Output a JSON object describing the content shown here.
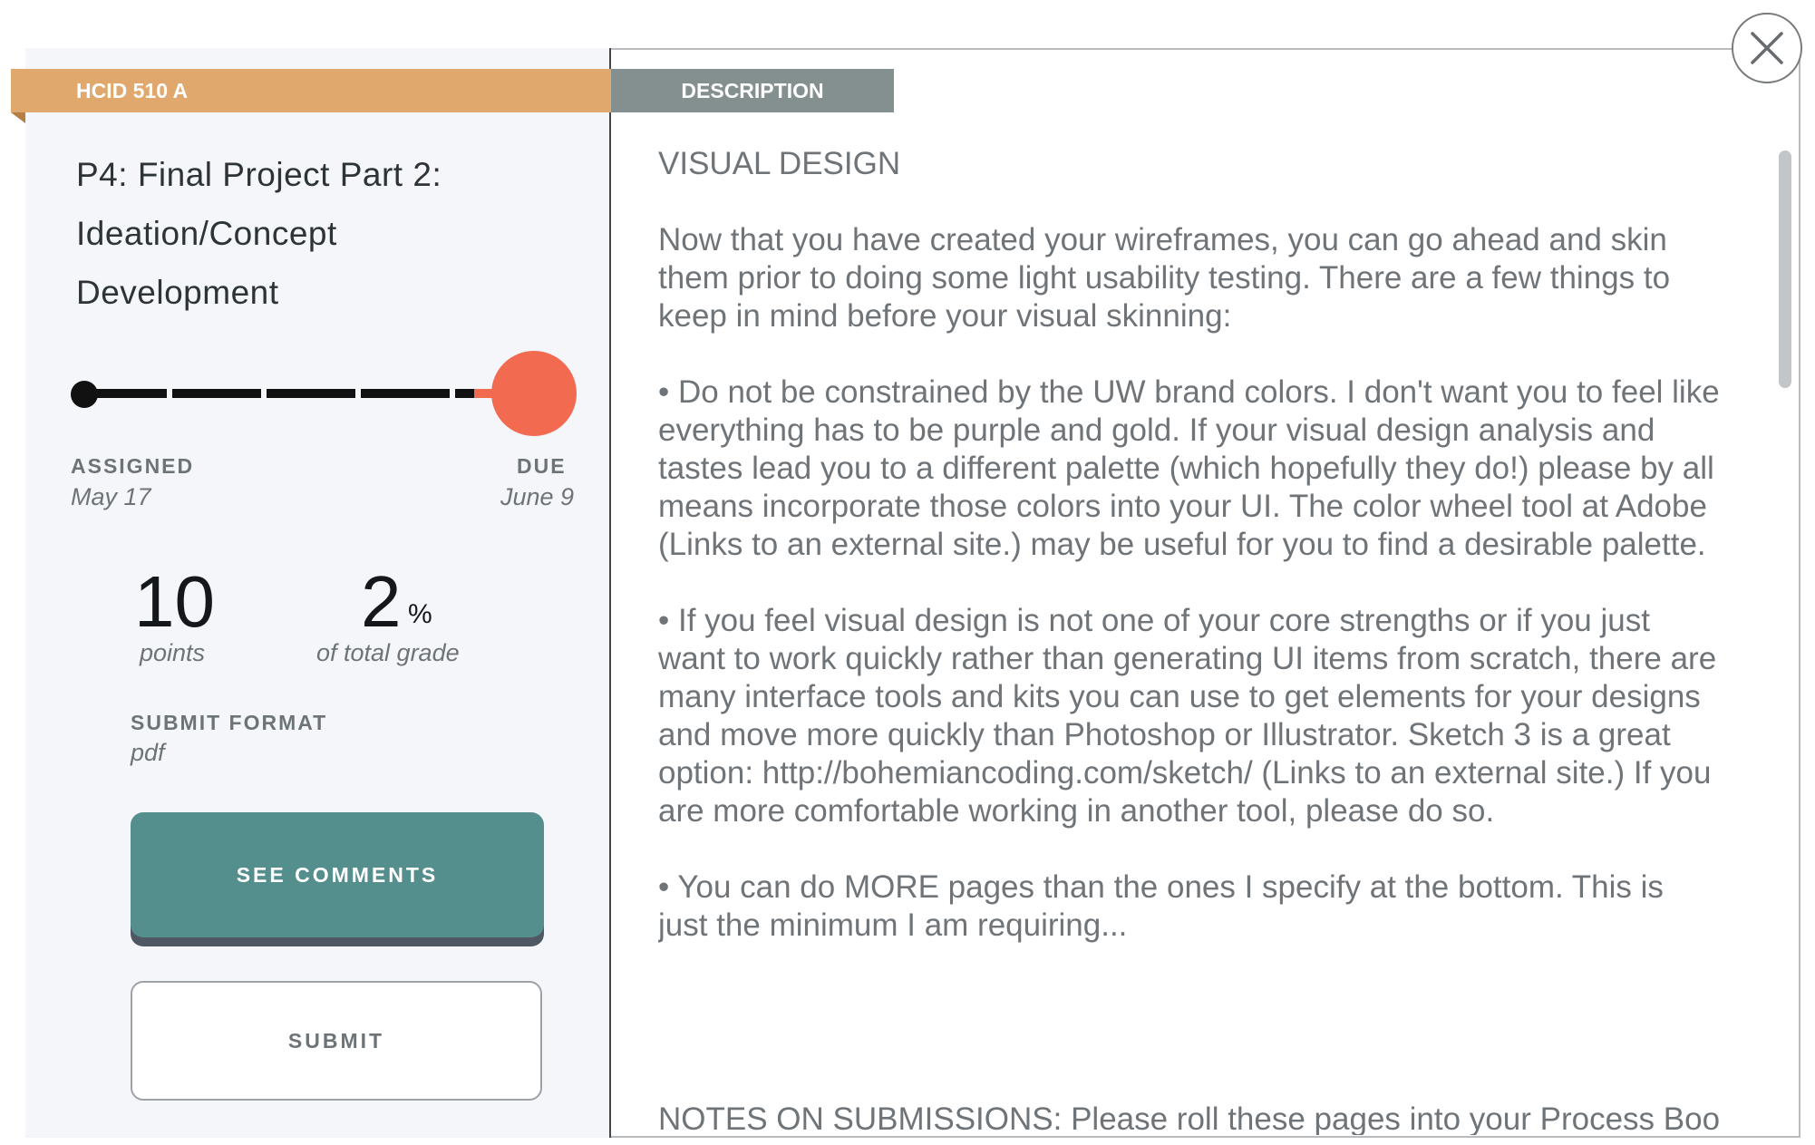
{
  "course": {
    "code": "HCID 510 A"
  },
  "tab": {
    "description_label": "DESCRIPTION"
  },
  "assignment": {
    "title_lines": [
      "P4: Final Project Part 2:",
      "Ideation/Concept",
      "Development"
    ],
    "assigned_label": "ASSIGNED",
    "assigned_date": "May 17",
    "due_label": "DUE",
    "due_date": "June 9",
    "timeline_progress": 0.86,
    "points_value": "10",
    "points_label": "points",
    "grade_value": "2",
    "grade_unit": "%",
    "grade_label": "of total grade",
    "submit_format_label": "SUBMIT FORMAT",
    "submit_format_value": "pdf"
  },
  "buttons": {
    "see_comments": "SEE COMMENTS",
    "submit": "SUBMIT"
  },
  "description": {
    "heading": "VISUAL DESIGN",
    "paragraphs": [
      "Now that you have created your wireframes, you can go ahead and skin them prior to doing some light usability testing. There are a few things to keep in mind before your visual skinning:",
      "• Do not be constrained by the UW brand colors. I don't want you to feel like everything has to be purple and gold. If your visual design analysis and tastes lead you to a different palette (which hopefully they do!) please by all means incorporate those colors into your UI. The color wheel tool at Adobe (Links to an external site.) may be useful for you to find a desirable palette.",
      "• If you feel visual design is not one of your core strengths or if you just want to work quickly rather than generating UI items from scratch, there are many interface tools and kits you can use to get elements for your designs and move more quickly than Photoshop or Illustrator. Sketch 3 is a great option: http://bohemiancoding.com/sketch/ (Links to an external site.)    If you are more comfortable working in another tool, please do so.",
      "• You can do MORE pages than the ones I specify at the bottom. This is just the minimum I am requiring..."
    ],
    "notes": "NOTES ON SUBMISSIONS: Please roll these pages into your Process Book."
  },
  "colors": {
    "ribbon": "#e0a86c",
    "description_tab": "#84908f",
    "accent_due": "#f26a50",
    "comments_button": "#548f8d"
  },
  "icons": {
    "close": "close-x-icon"
  }
}
